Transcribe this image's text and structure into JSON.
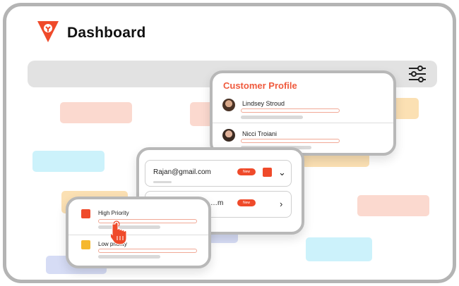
{
  "header": {
    "title": "Dashboard"
  },
  "customer_profile": {
    "title": "Customer Profile",
    "people": [
      {
        "name": "Lindsey Stroud"
      },
      {
        "name": "Nicci Troiani"
      }
    ]
  },
  "contacts": {
    "rows": [
      {
        "email": "Rajan@gmail.com",
        "badge": "New",
        "expanded": true
      },
      {
        "email": "…m",
        "badge": "New",
        "expanded": false
      }
    ]
  },
  "priorities": {
    "items": [
      {
        "label": "High Priority",
        "color": "#ef4a2a"
      },
      {
        "label": "Low priority",
        "color": "#f5b82e"
      }
    ]
  },
  "colors": {
    "brand": "#ef4a2a",
    "accent_title": "#ef5a3d",
    "tile_peach": "#fbd9cf",
    "tile_cyan": "#ccf2fb",
    "tile_orange": "#fbe0b3",
    "tile_lavender": "#d6dcf5"
  },
  "icons": [
    "logo-icon",
    "filter-sliders-icon",
    "chevron-down-icon",
    "chevron-right-icon",
    "pointer-hand-icon"
  ]
}
